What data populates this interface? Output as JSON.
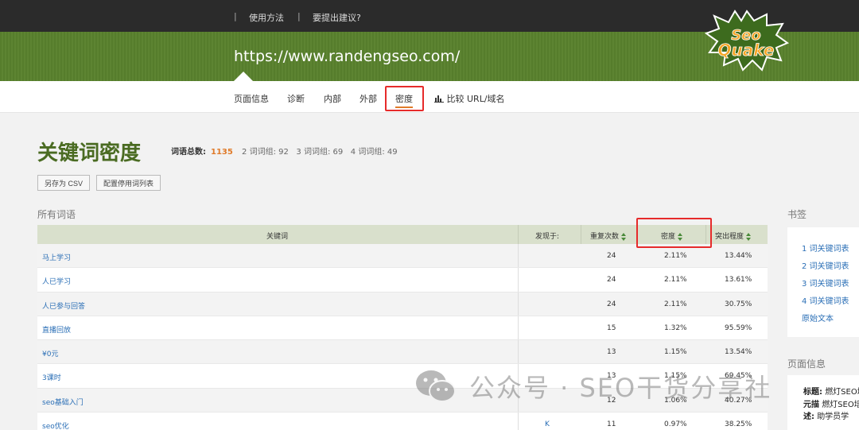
{
  "topbar": {
    "sep": "|",
    "links": [
      "使用方法",
      "要提出建议?"
    ]
  },
  "hero": {
    "url": "https://www.randengseo.com/",
    "logo_text_top": "Seo",
    "logo_text_bottom": "Quake"
  },
  "nav": {
    "tabs": [
      "页面信息",
      "诊断",
      "内部",
      "外部",
      "密度"
    ],
    "compare": "比较 URL/域名",
    "active": "密度"
  },
  "main": {
    "title": "关键词密度",
    "stats_label": "词语总数:",
    "total": "1135",
    "group2": "2 词词组: 92",
    "group3": "3 词词组: 69",
    "group4": "4 词词组: 49",
    "btn_csv": "另存为 CSV",
    "btn_stopwords": "配置停用词列表",
    "section": "所有词语"
  },
  "table": {
    "headers": {
      "keyword": "关键词",
      "found": "发现于:",
      "repeat": "重复次数",
      "density": "密度",
      "prominence": "突出程度"
    },
    "rows": [
      {
        "keyword": "马上学习",
        "found": "",
        "repeat": "24",
        "density": "2.11%",
        "prominence": "13.44%"
      },
      {
        "keyword": "人已学习",
        "found": "",
        "repeat": "24",
        "density": "2.11%",
        "prominence": "13.61%"
      },
      {
        "keyword": "人已参与回答",
        "found": "",
        "repeat": "24",
        "density": "2.11%",
        "prominence": "30.75%"
      },
      {
        "keyword": "直播回放",
        "found": "",
        "repeat": "15",
        "density": "1.32%",
        "prominence": "95.59%"
      },
      {
        "keyword": "¥0元",
        "found": "",
        "repeat": "13",
        "density": "1.15%",
        "prominence": "13.54%"
      },
      {
        "keyword": "3课时",
        "found": "",
        "repeat": "13",
        "density": "1.15%",
        "prominence": "69.45%"
      },
      {
        "keyword": "seo基础入门",
        "found": "",
        "repeat": "12",
        "density": "1.06%",
        "prominence": "40.27%"
      },
      {
        "keyword": "seo优化",
        "found": "K",
        "repeat": "11",
        "density": "0.97%",
        "prominence": "38.25%"
      }
    ]
  },
  "sidebar": {
    "bookmarks_title": "书签",
    "links": [
      "1 词关键词表",
      "2 词关键词表",
      "3 词关键词表",
      "4 词关键词表",
      "原始文本"
    ],
    "pageinfo_title": "页面信息",
    "info": [
      {
        "label": "标题:",
        "value": "燃灯SEO培"
      },
      {
        "label": "元描",
        "value": "燃灯SEO培"
      },
      {
        "label": "述:",
        "value": "助学员学"
      }
    ]
  },
  "watermark": {
    "text": "公众号 · SEO干货分享社"
  },
  "colors": {
    "accent": "#e07b2a",
    "brand_green": "#5a822e",
    "title_green": "#4a6b22",
    "link_blue": "#2b6fb6",
    "highlight_red": "#e62b2b"
  }
}
